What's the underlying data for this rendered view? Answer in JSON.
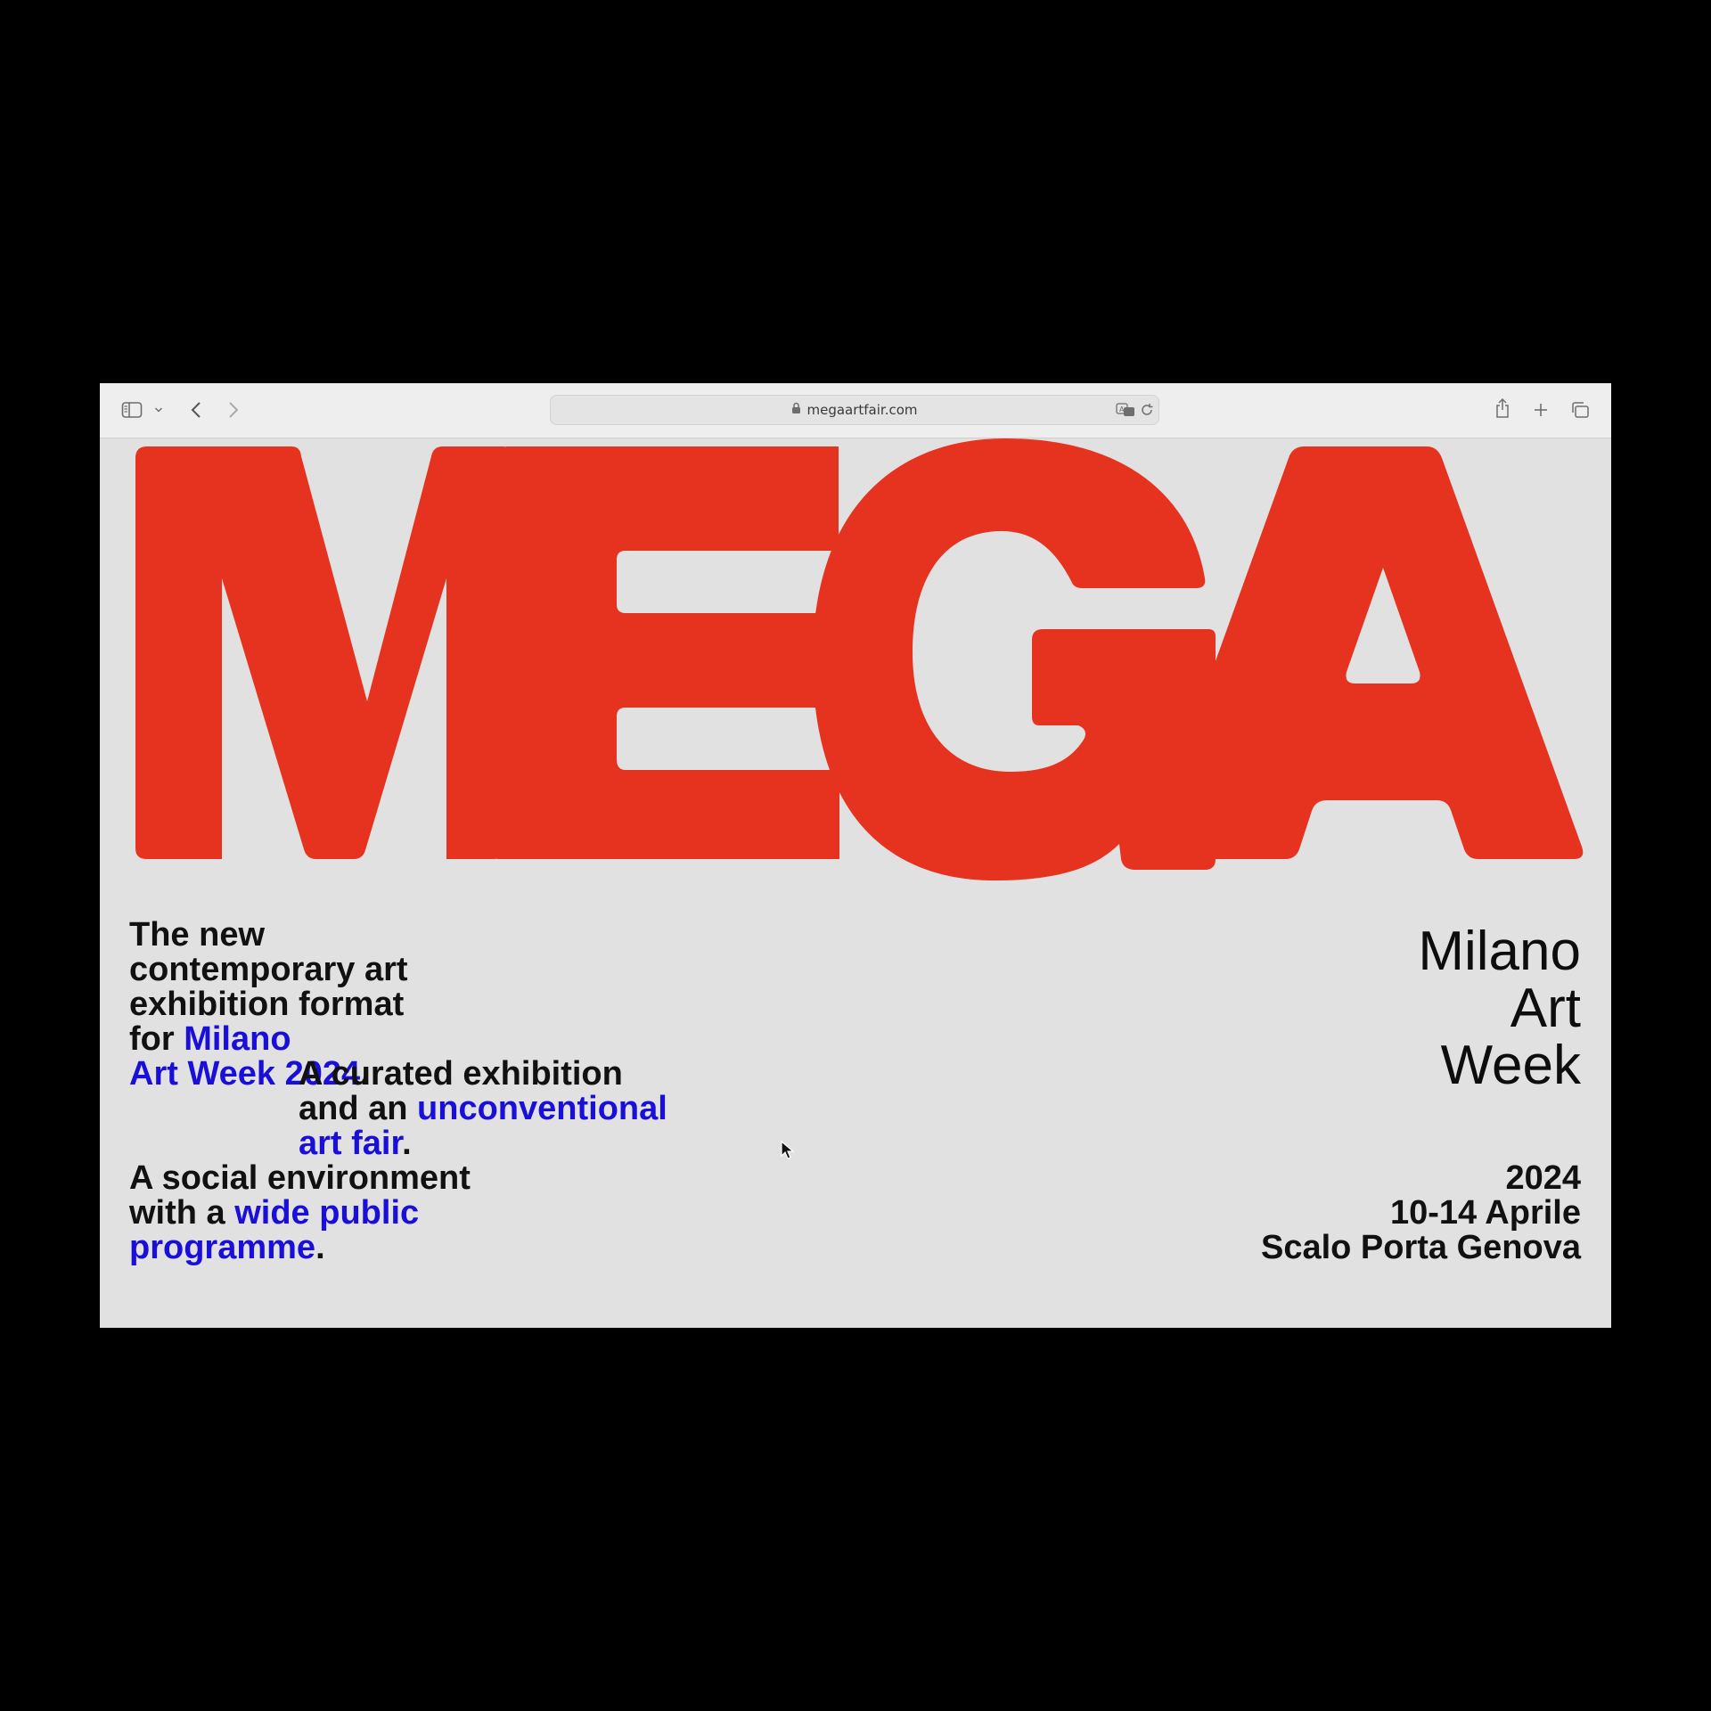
{
  "browser": {
    "url": "megaartfair.com",
    "icons": [
      "sidebar-icon",
      "chevron-down-icon",
      "back-arrow-icon",
      "forward-arrow-icon",
      "lock-icon",
      "translate-icon",
      "reload-icon",
      "share-icon",
      "new-tab-icon",
      "tabs-overview-icon"
    ]
  },
  "page": {
    "logo_text": "MEGA",
    "logo_color": "#e6331f",
    "accent_color": "#1a0fd8",
    "background_color": "#e1e1e1",
    "intro": {
      "line1": "The new",
      "line2": "contemporary art",
      "line3": "exhibition format",
      "line4_prefix": "for ",
      "line4_accent": "Milano",
      "line5_accent": "Art Week 2024",
      "line5_suffix": "."
    },
    "curated": {
      "line1": "A curated exhibition",
      "line2_prefix": "and an ",
      "line2_accent": "unconventional",
      "line3_accent": "art fair",
      "line3_suffix": "."
    },
    "social": {
      "line1": "A social environment",
      "line2_prefix": "with a ",
      "line2_accent": "wide public",
      "line3_accent": "programme",
      "line3_suffix": "."
    },
    "event_name": [
      "Milano",
      "Art",
      "Week"
    ],
    "event_details": {
      "year": "2024",
      "dates": "10-14 Aprile",
      "venue": "Scalo Porta Genova"
    }
  }
}
